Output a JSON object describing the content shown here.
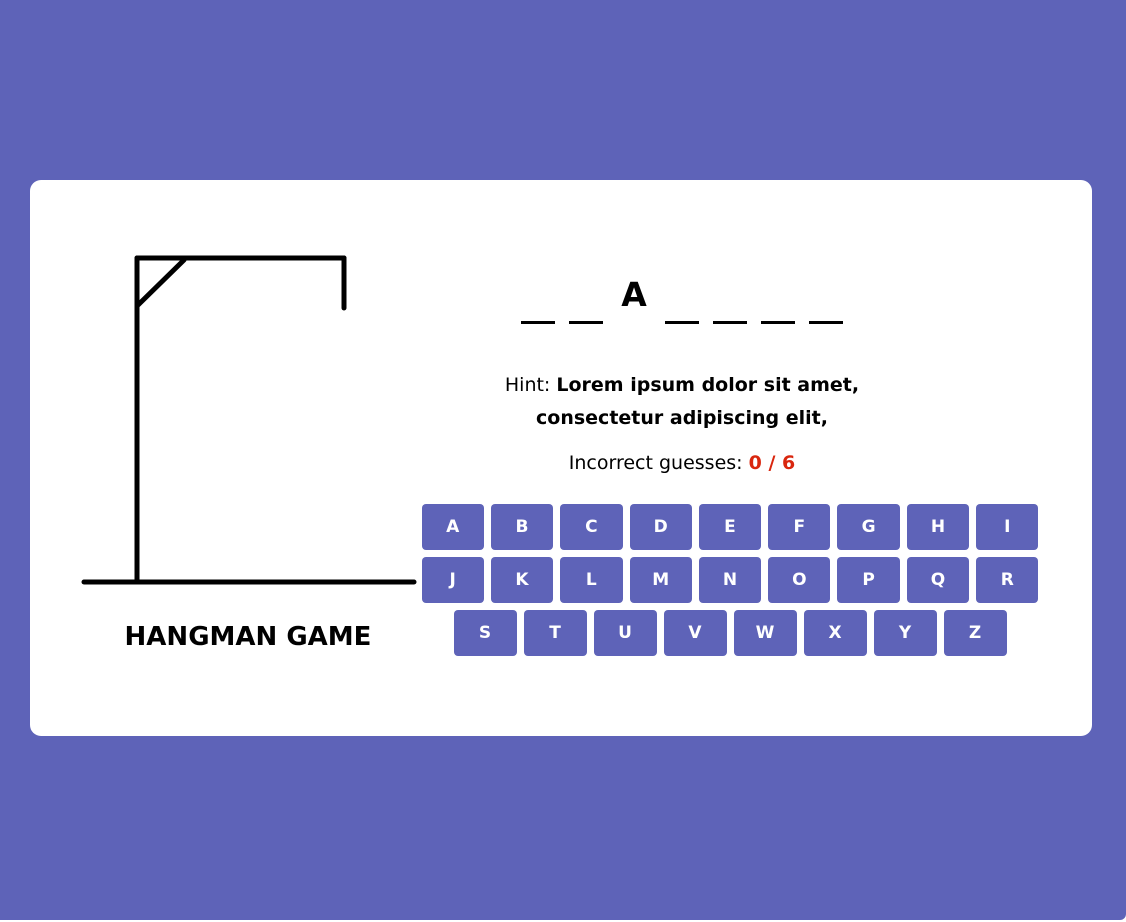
{
  "title": "HANGMAN GAME",
  "word": {
    "letters": [
      "",
      "",
      "A",
      "",
      "",
      "",
      ""
    ]
  },
  "hint": {
    "label": "Hint: ",
    "text": "Lorem ipsum dolor sit amet, consectetur adipiscing elit,"
  },
  "guesses": {
    "label": "Incorrect guesses: ",
    "count": "0 / 6",
    "wrong": 0,
    "max": 6
  },
  "keyboard": {
    "rows": [
      [
        "A",
        "B",
        "C",
        "D",
        "E",
        "F",
        "G",
        "H",
        "I"
      ],
      [
        "J",
        "K",
        "L",
        "M",
        "N",
        "O",
        "P",
        "Q",
        "R"
      ],
      [
        "S",
        "T",
        "U",
        "V",
        "W",
        "X",
        "Y",
        "Z"
      ]
    ]
  },
  "colors": {
    "accent": "#5e63b8",
    "error": "#d9260e"
  },
  "icons": {
    "gallows": "gallows-icon"
  }
}
